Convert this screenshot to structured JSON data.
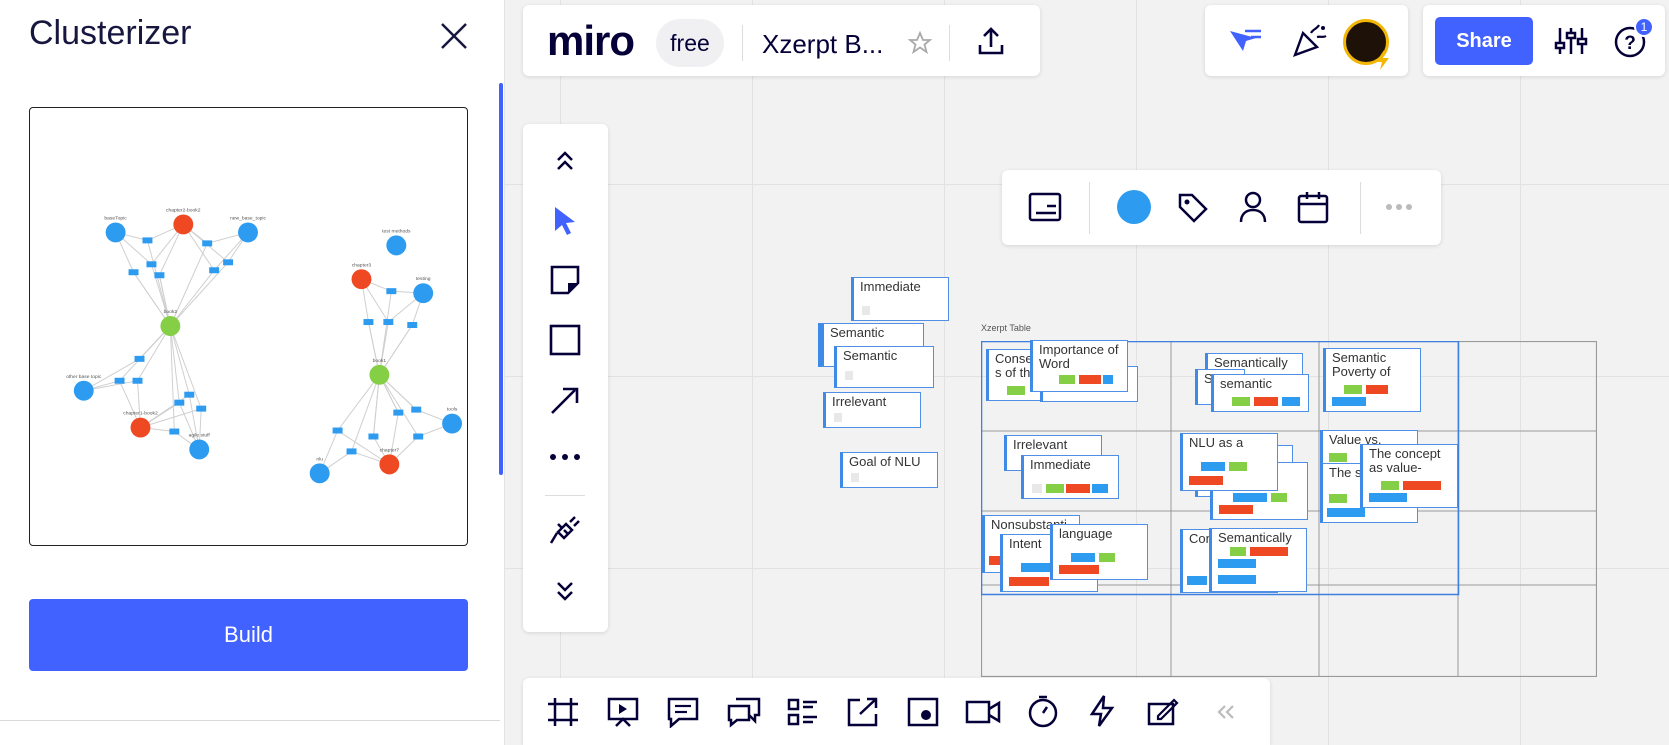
{
  "panel": {
    "title": "Clusterizer",
    "build_label": "Build",
    "graph": {
      "clusters": [
        {
          "nodes": [
            {
              "label": "baseTopic",
              "color": "blue"
            },
            {
              "label": "chapter2-book2",
              "color": "red"
            },
            {
              "label": "new_base_topic",
              "color": "blue"
            },
            {
              "label": "book2",
              "color": "green"
            },
            {
              "label": "other base topic",
              "color": "blue"
            },
            {
              "label": "chapter1-book2",
              "color": "red"
            },
            {
              "label": "agile stuff",
              "color": "blue"
            }
          ]
        },
        {
          "nodes": [
            {
              "label": "test methods",
              "color": "blue"
            },
            {
              "label": "chapter3",
              "color": "red"
            },
            {
              "label": "testing",
              "color": "blue"
            },
            {
              "label": "book1",
              "color": "green"
            },
            {
              "label": "tools",
              "color": "blue"
            },
            {
              "label": "nlu",
              "color": "blue"
            },
            {
              "label": "chapter7",
              "color": "red"
            }
          ]
        }
      ]
    }
  },
  "header": {
    "logo": "miro",
    "plan": "free",
    "board_name": "Xzerpt B...",
    "share_label": "Share",
    "help_badge": "1"
  },
  "colors": {
    "accent": "#4262ff",
    "red": "#ef4923",
    "green": "#84cf46",
    "blue": "#2d9bf0"
  },
  "toolbar": {
    "tools": [
      "collapse-up-icon",
      "select-icon",
      "sticky-note-icon",
      "rectangle-icon",
      "arrow-icon",
      "more-icon",
      "plugin-icon",
      "expand-down-icon"
    ]
  },
  "context_toolbar": {
    "tools": [
      "card-icon",
      "color-swatch-icon",
      "tag-icon",
      "assignee-icon",
      "date-icon",
      "more-icon"
    ]
  },
  "bottom_toolbar": {
    "tools": [
      "frames-icon",
      "presentation-icon",
      "comments-icon",
      "chat-icon",
      "cards-list-icon",
      "share-screen-icon",
      "embed-icon",
      "video-icon",
      "timer-icon",
      "lightning-icon",
      "notes-icon",
      "collapse-left-icon"
    ]
  },
  "board": {
    "table_title": "Xzerpt Table",
    "cards": {
      "immediate_top": "Immediate",
      "semantic_stack_back": "Semantic",
      "semantic_stack_front": "Semantic",
      "irrelevant_left": "Irrelevant",
      "goal_nlu": "Goal of NLU",
      "conse": "Conse s of th",
      "importance": "Importance of Word",
      "semantically_top": "Semantically",
      "semantic_small": "semantic",
      "s_back": "S",
      "semantic_poverty": "Semantic Poverty of",
      "irrelevant_table": "Irrelevant",
      "immediate_table": "Immediate",
      "nlu_as_a": "NLU as a",
      "value_vs": "Value vs.",
      "the_concept": "The concept as value-",
      "the_sy": "The sy",
      "nonsubstanti": "Nonsubstanti",
      "intent": "Intent",
      "language": "language",
      "con_so": "Con s o",
      "semantically_bottom": "Semantically"
    }
  }
}
